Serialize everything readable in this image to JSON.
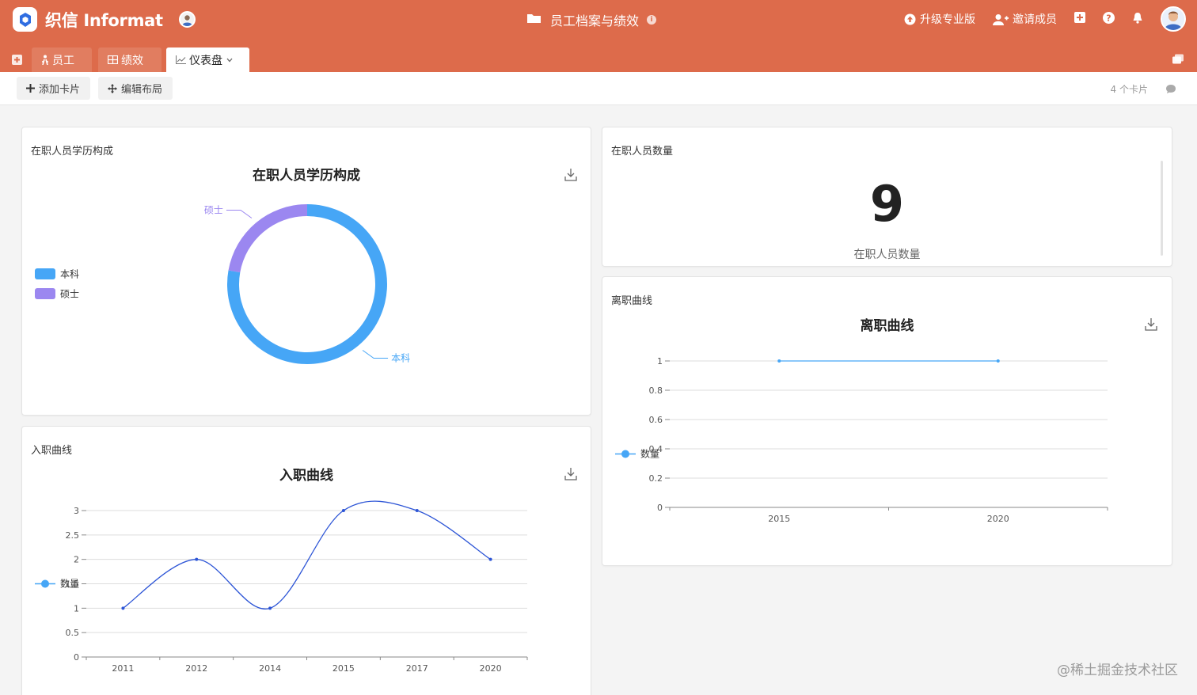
{
  "app": {
    "brand": "织信 Informat",
    "title": "员工档案与绩效"
  },
  "top_right": {
    "upgrade": "升级专业版",
    "invite": "邀请成员"
  },
  "tabs": [
    {
      "label": "员工",
      "icon": "person-icon"
    },
    {
      "label": "绩效",
      "icon": "table-icon"
    },
    {
      "label": "仪表盘",
      "icon": "chart-icon"
    }
  ],
  "toolbar": {
    "add_card": "添加卡片",
    "edit_layout": "编辑布局",
    "card_count": "4 个卡片"
  },
  "cards": {
    "education": {
      "label": "在职人员学历构成",
      "chart_data": {
        "type": "pie",
        "title": "在职人员学历构成",
        "slices": [
          {
            "name": "本科",
            "value": 7,
            "color": "#46a6f6"
          },
          {
            "name": "硕士",
            "value": 2,
            "color": "#9b87f0"
          }
        ],
        "legend_placement": "left"
      }
    },
    "headcount": {
      "label": "在职人员数量",
      "value": "9",
      "sub": "在职人员数量"
    },
    "leaving": {
      "label": "离职曲线",
      "chart_data": {
        "type": "line",
        "title": "离职曲线",
        "categories": [
          "2015",
          "2020"
        ],
        "series": [
          {
            "name": "数量",
            "values": [
              1,
              1
            ],
            "color": "#46a6f6"
          }
        ],
        "ylim": [
          0,
          1
        ],
        "yticks": [
          "0",
          "0.2",
          "0.4",
          "0.6",
          "0.8",
          "1"
        ],
        "grid": true,
        "legend_placement": "left"
      }
    },
    "hiring": {
      "label": "入职曲线",
      "chart_data": {
        "type": "line",
        "title": "入职曲线",
        "categories": [
          "2011",
          "2012",
          "2014",
          "2015",
          "2017",
          "2020"
        ],
        "series": [
          {
            "name": "数量",
            "values": [
              1,
              2,
              1,
              3,
              3,
              2
            ],
            "color": "#2d55d6"
          }
        ],
        "ylim": [
          0,
          3
        ],
        "yticks": [
          "0",
          "0.5",
          "1",
          "1.5",
          "2",
          "2.5",
          "3"
        ],
        "grid": true,
        "legend_placement": "left"
      }
    }
  },
  "watermark": "@稀土掘金技术社区"
}
